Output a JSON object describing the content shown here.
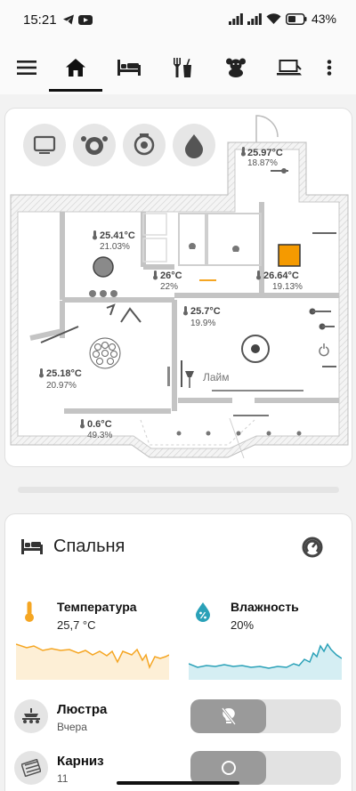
{
  "status_bar": {
    "time": "15:21",
    "battery_text": "43%",
    "left_icons": [
      "telegram-icon",
      "youtube-icon"
    ],
    "right_icons": [
      "signal-icon",
      "signal-icon",
      "wifi-icon",
      "battery-icon"
    ]
  },
  "toolbar": {
    "icons": [
      "menu-icon",
      "home-icon",
      "bed-icon",
      "dining-icon",
      "teddy-bear-icon",
      "laptop-icon",
      "more-vert-icon"
    ],
    "active_tab": "home-icon"
  },
  "floorplan": {
    "room_sensors": [
      {
        "temp": "25.97°C",
        "humidity": "18.87%"
      },
      {
        "temp": "25.41°C",
        "humidity": "21.03%"
      },
      {
        "temp": "26°C",
        "humidity": "22%"
      },
      {
        "temp": "26.64°C",
        "humidity": "19.13%"
      },
      {
        "temp": "25.7°C",
        "humidity": "19.9%"
      },
      {
        "temp": "25.18°C",
        "humidity": "20.97%"
      },
      {
        "temp": "0.6°C",
        "humidity": "49.3%"
      }
    ],
    "lamp_label": "Лайм",
    "quick_buttons": [
      "tv-icon",
      "robot-vacuum-icon",
      "vacuum-icon",
      "water-drop-icon"
    ],
    "accent_color": "#f59a00"
  },
  "room": {
    "title": "Спальня",
    "temperature": {
      "label": "Температура",
      "value": "25,7 °C",
      "color": "#f5a623"
    },
    "humidity": {
      "label": "Влажность",
      "value": "20%",
      "color": "#2aa1b8"
    },
    "entities": [
      {
        "name": "Люстра",
        "state": "Вчера",
        "icon": "chandelier-icon",
        "toggle_icon": "lightbulb-off-icon"
      },
      {
        "name": "Карниз",
        "state": "11",
        "icon": "curtain-icon",
        "toggle_icon": "circle-outline-icon"
      }
    ]
  }
}
